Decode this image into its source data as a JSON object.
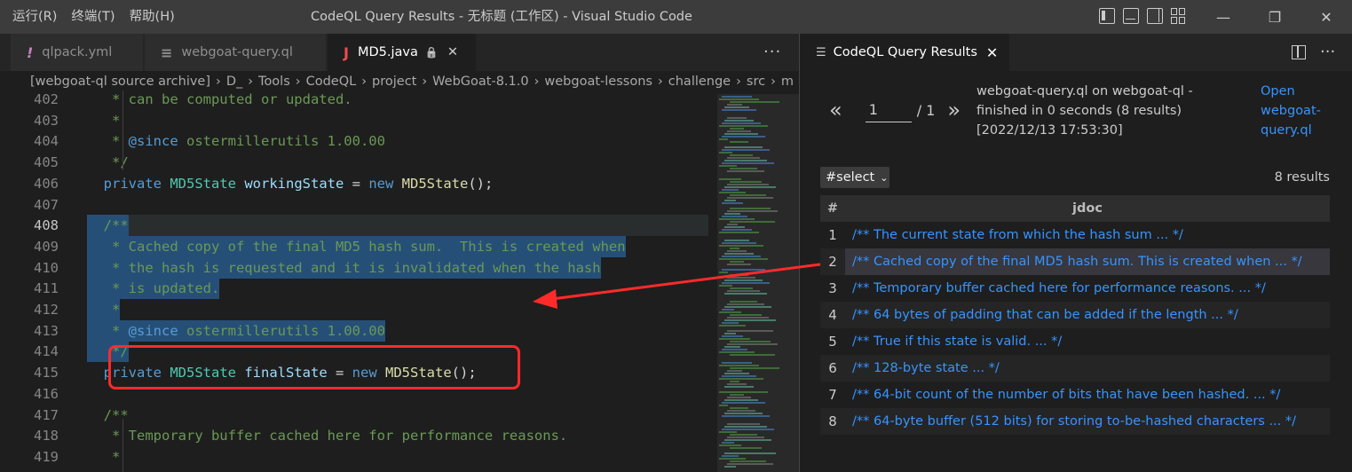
{
  "window": {
    "title": "CodeQL Query Results - 无标题 (工作区) - Visual Studio Code",
    "menu": [
      "运行(R)",
      "终端(T)",
      "帮助(H)"
    ],
    "controls": {
      "minimize": "—",
      "restore": "❐",
      "close": "✕"
    }
  },
  "tabs": [
    {
      "icon": "!",
      "icon_color": "#c586c0",
      "label": "qlpack.yml"
    },
    {
      "icon": "≡",
      "icon_color": "#8f8f8f",
      "label": "webgoat-query.ql"
    },
    {
      "icon": "J",
      "icon_color": "#f14c4c",
      "label": "MD5.java",
      "lock": "🔒",
      "close": "✕"
    }
  ],
  "editor_more": "···",
  "breadcrumb": [
    "[webgoat-ql source archive]",
    "D_",
    "Tools",
    "CodeQL",
    "project",
    "WebGoat-8.1.0",
    "webgoat-lessons",
    "challenge",
    "src",
    "m"
  ],
  "code": {
    "lines": [
      {
        "n": "402",
        "tokens": [
          {
            "t": "   * can be computed or updated.",
            "c": "c-com"
          }
        ]
      },
      {
        "n": "403",
        "tokens": [
          {
            "t": "   *",
            "c": "c-com"
          }
        ]
      },
      {
        "n": "404",
        "tokens": [
          {
            "t": "   * ",
            "c": "c-com"
          },
          {
            "t": "@since",
            "c": "c-ann"
          },
          {
            "t": " ostermillerutils 1.00.00",
            "c": "c-com"
          }
        ]
      },
      {
        "n": "405",
        "tokens": [
          {
            "t": "   */",
            "c": "c-com"
          }
        ]
      },
      {
        "n": "406",
        "tokens": [
          {
            "t": "  private ",
            "c": "c-kw"
          },
          {
            "t": "MD5State",
            "c": "c-type"
          },
          {
            "t": " ",
            "c": "c-punc"
          },
          {
            "t": "workingState",
            "c": "c-var"
          },
          {
            "t": " = ",
            "c": "c-punc"
          },
          {
            "t": "new",
            "c": "c-kw"
          },
          {
            "t": " ",
            "c": "c-punc"
          },
          {
            "t": "MD5State",
            "c": "c-fn"
          },
          {
            "t": "();",
            "c": "c-punc"
          }
        ]
      },
      {
        "n": "407",
        "tokens": []
      },
      {
        "n": "408",
        "tokens": [
          {
            "t": "  /**",
            "c": "c-com"
          }
        ]
      },
      {
        "n": "409",
        "tokens": [
          {
            "t": "   * Cached copy of the final MD5 hash sum.  This is created when",
            "c": "c-com"
          }
        ]
      },
      {
        "n": "410",
        "tokens": [
          {
            "t": "   * the hash is requested and it is invalidated when the hash",
            "c": "c-com"
          }
        ]
      },
      {
        "n": "411",
        "tokens": [
          {
            "t": "   * is updated.",
            "c": "c-com"
          }
        ]
      },
      {
        "n": "412",
        "tokens": [
          {
            "t": "   *",
            "c": "c-com"
          }
        ]
      },
      {
        "n": "413",
        "tokens": [
          {
            "t": "   * ",
            "c": "c-com"
          },
          {
            "t": "@since",
            "c": "c-ann"
          },
          {
            "t": " ostermillerutils 1.00.00",
            "c": "c-com"
          }
        ]
      },
      {
        "n": "414",
        "tokens": [
          {
            "t": "   */",
            "c": "c-com"
          }
        ]
      },
      {
        "n": "415",
        "tokens": [
          {
            "t": "  private ",
            "c": "c-kw"
          },
          {
            "t": "MD5State",
            "c": "c-type"
          },
          {
            "t": " ",
            "c": "c-punc"
          },
          {
            "t": "finalState",
            "c": "c-var"
          },
          {
            "t": " = ",
            "c": "c-punc"
          },
          {
            "t": "new",
            "c": "c-kw"
          },
          {
            "t": " ",
            "c": "c-punc"
          },
          {
            "t": "MD5State",
            "c": "c-fn"
          },
          {
            "t": "();",
            "c": "c-punc"
          }
        ]
      },
      {
        "n": "416",
        "tokens": []
      },
      {
        "n": "417",
        "tokens": [
          {
            "t": "  /**",
            "c": "c-com"
          }
        ]
      },
      {
        "n": "418",
        "tokens": [
          {
            "t": "   * Temporary buffer cached here for performance reasons.",
            "c": "c-com"
          }
        ]
      },
      {
        "n": "419",
        "tokens": [
          {
            "t": "   *",
            "c": "c-com"
          }
        ]
      }
    ],
    "current_line": "408",
    "selected_lines": [
      "408",
      "409",
      "410",
      "411",
      "412",
      "413",
      "414"
    ]
  },
  "results_panel": {
    "tab_label": "CodeQL Query Results",
    "tab_close": "✕",
    "more": "···",
    "pager": {
      "prev": "«",
      "page": "1",
      "total": "/ 1",
      "next": "»"
    },
    "query_info": [
      "webgoat-query.ql on webgoat-ql -",
      "finished in 0 seconds (8 results)",
      "[2022/12/13 17:53:30]"
    ],
    "open_link": [
      "Open",
      "webgoat-",
      "query.ql"
    ],
    "select_label": "#select",
    "results_count": "8 results",
    "columns": [
      "#",
      "jdoc"
    ],
    "rows": [
      {
        "num": "1",
        "jdoc": "/** The current state from which the hash sum ... */"
      },
      {
        "num": "2",
        "jdoc": "/** Cached copy of the final MD5 hash sum.  This is created when ... */"
      },
      {
        "num": "3",
        "jdoc": "/** Temporary buffer cached here for performance reasons. ... */"
      },
      {
        "num": "4",
        "jdoc": "/** 64 bytes of padding that can be added if the length ... */"
      },
      {
        "num": "5",
        "jdoc": "/** True if this state is valid. ... */"
      },
      {
        "num": "6",
        "jdoc": "/** 128-byte state ... */"
      },
      {
        "num": "7",
        "jdoc": "/** 64-bit count of the number of bits that have been hashed. ... */"
      },
      {
        "num": "8",
        "jdoc": "/** 64-byte buffer (512 bits) for storing to-be-hashed characters ... */"
      }
    ],
    "highlighted_row": "2"
  },
  "colors": {
    "annotation": "#ff2a2a",
    "link": "#3794ff",
    "selection": "#264f78"
  }
}
